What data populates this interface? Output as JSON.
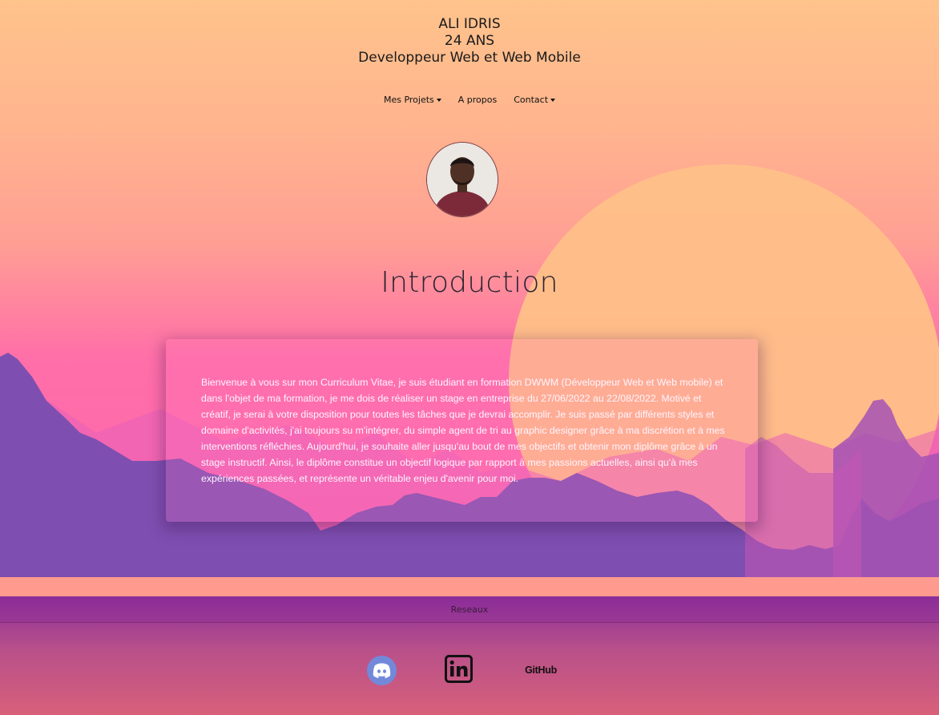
{
  "header": {
    "name": "ALI IDRIS",
    "age": "24 ANS",
    "role": "Developpeur Web et Web Mobile"
  },
  "nav": {
    "projects": "Mes Projets",
    "about": "A propos",
    "contact": "Contact"
  },
  "intro": {
    "title": "Introduction",
    "text": "Bienvenue à vous sur mon Curriculum Vitae, je suis étudiant en formation DWWM (Développeur Web et Web mobile) et dans l'objet de ma formation, je me dois de réaliser un stage en entreprise du 27/06/2022 au 22/08/2022. Motivé et créatif, je serai à votre disposition pour toutes les tâches que je devrai accomplir. Je suis passé par différents styles et domaine d'activités, j'ai toujours su m'intégrer, du simple agent de tri au graphic designer grâce à ma discrétion et à mes interventions réfléchies. Aujourd'hui, je souhaite aller jusqu'au bout de mes objectifs et obtenir mon diplôme grâce à un stage instructif. Ainsi, le diplôme constitue un objectif logique par rapport à mes passions actuelles, ainsi qu'à mes expériences passées, et représente un véritable enjeu d'avenir pour moi."
  },
  "footer": {
    "title": "Reseaux",
    "github_label": "GitHub"
  },
  "icons": {
    "discord": "discord-icon",
    "linkedin": "linkedin-icon",
    "github": "github-icon"
  },
  "colors": {
    "discord": "#7289da",
    "sky_top": "#ffc38c",
    "mountains": "#7e4fb0"
  }
}
